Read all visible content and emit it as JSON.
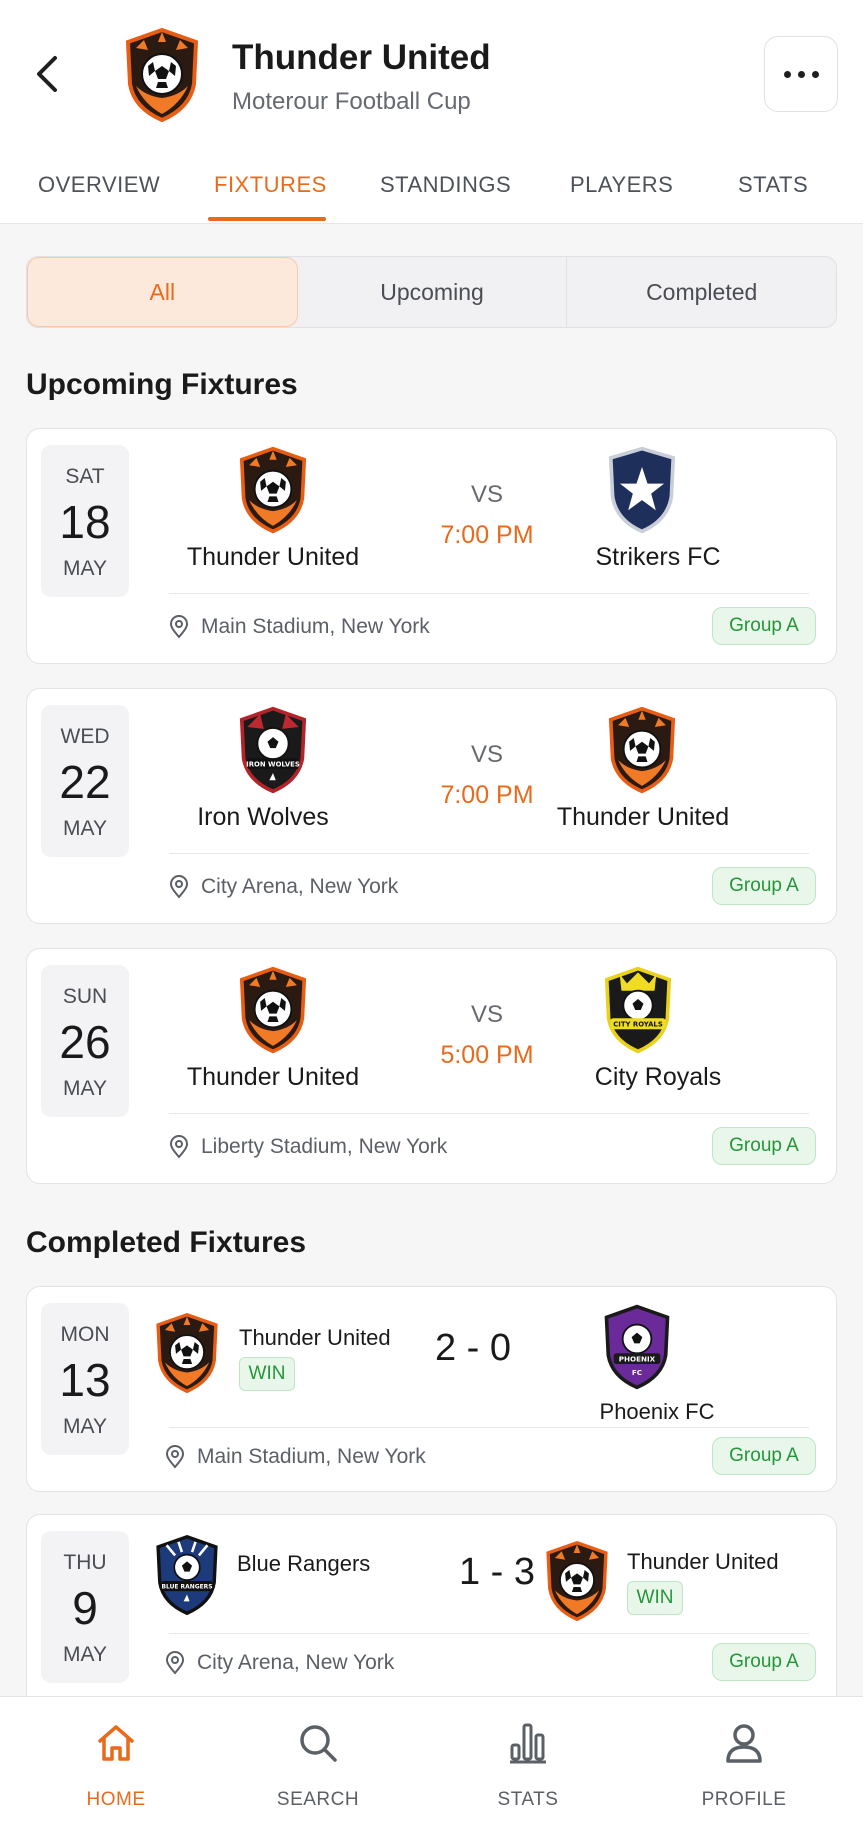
{
  "header": {
    "title": "Thunder United",
    "subtitle": "Moterour Football Cup"
  },
  "tabs": [
    "OVERVIEW",
    "FIXTURES",
    "STANDINGS",
    "PLAYERS",
    "STATS"
  ],
  "active_tab": "FIXTURES",
  "filter": {
    "options": [
      "All",
      "Upcoming",
      "Completed"
    ],
    "selected": "All"
  },
  "upcoming": {
    "title": "Upcoming Fixtures",
    "fixtures": [
      {
        "dow": "SAT",
        "day": "18",
        "month": "MAY",
        "home": "Thunder United",
        "away": "Strikers FC",
        "vs": "VS",
        "time": "7:00 PM",
        "venue": "Main Stadium, New York",
        "group": "Group A"
      },
      {
        "dow": "WED",
        "day": "22",
        "month": "MAY",
        "home": "Iron Wolves",
        "away": "Thunder United",
        "vs": "VS",
        "time": "7:00 PM",
        "venue": "City Arena, New York",
        "group": "Group A"
      },
      {
        "dow": "SUN",
        "day": "26",
        "month": "MAY",
        "home": "Thunder United",
        "away": "City Royals",
        "vs": "VS",
        "time": "5:00 PM",
        "venue": "Liberty Stadium, New York",
        "group": "Group A"
      }
    ]
  },
  "completed": {
    "title": "Completed Fixtures",
    "fixtures": [
      {
        "dow": "MON",
        "day": "13",
        "month": "MAY",
        "home": "Thunder United",
        "away": "Phoenix FC",
        "score": "2 - 0",
        "result": "WIN",
        "venue": "Main Stadium, New York",
        "group": "Group A"
      },
      {
        "dow": "THU",
        "day": "9",
        "month": "MAY",
        "home": "Blue Rangers",
        "away": "Thunder United",
        "score": "1 - 3",
        "result": "WIN",
        "venue": "City Arena, New York",
        "group": "Group A"
      }
    ]
  },
  "crest_labels": {
    "iron_wolves": "IRON WOLVES",
    "city_royals": "CITY ROYALS",
    "phoenix": "PHOENIX",
    "phoenix_fc": "FC",
    "blue_rangers": "BLUE RANGERS"
  },
  "bottom_nav": [
    {
      "label": "HOME",
      "icon": "home-icon"
    },
    {
      "label": "SEARCH",
      "icon": "search-icon"
    },
    {
      "label": "STATS",
      "icon": "stats-icon"
    },
    {
      "label": "PROFILE",
      "icon": "profile-icon"
    }
  ],
  "colors": {
    "accent": "#ea6a1c",
    "win_green": "#24963a",
    "badge_bg": "#e8f7ea"
  }
}
